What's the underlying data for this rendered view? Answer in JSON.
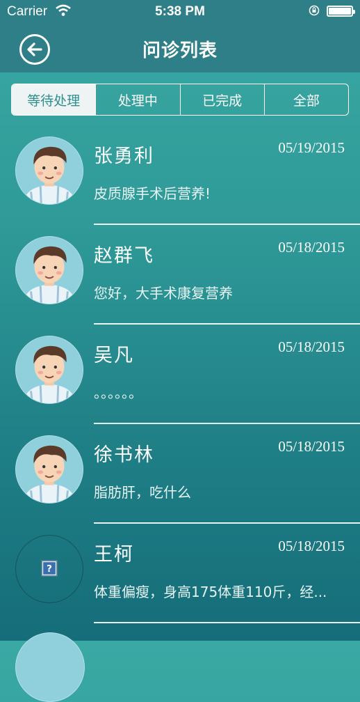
{
  "status": {
    "carrier": "Carrier",
    "time": "5:38 PM"
  },
  "nav": {
    "title": "问诊列表"
  },
  "tabs": [
    "等待处理",
    "处理中",
    "已完成",
    "全部"
  ],
  "active_tab": "等待处理",
  "items": [
    {
      "name": "张勇利",
      "date": "05/19/2015",
      "message": "皮质腺手术后营养!",
      "avatar": "doctor-avatar"
    },
    {
      "name": "赵群飞",
      "date": "05/18/2015",
      "message": "您好，大手术康复营养",
      "avatar": "doctor-avatar"
    },
    {
      "name": "吴凡",
      "date": "05/18/2015",
      "message": "。。。。。。",
      "avatar": "doctor-avatar"
    },
    {
      "name": "徐书林",
      "date": "05/18/2015",
      "message": "脂肪肝，吃什么",
      "avatar": "doctor-avatar"
    },
    {
      "name": "王柯",
      "date": "05/18/2015",
      "message": "体重偏瘦，身高175体重110斤，经...",
      "avatar": "placeholder"
    }
  ],
  "colors": {
    "accent": "#2e8f8f",
    "nav_bg": "#2e7f87"
  }
}
